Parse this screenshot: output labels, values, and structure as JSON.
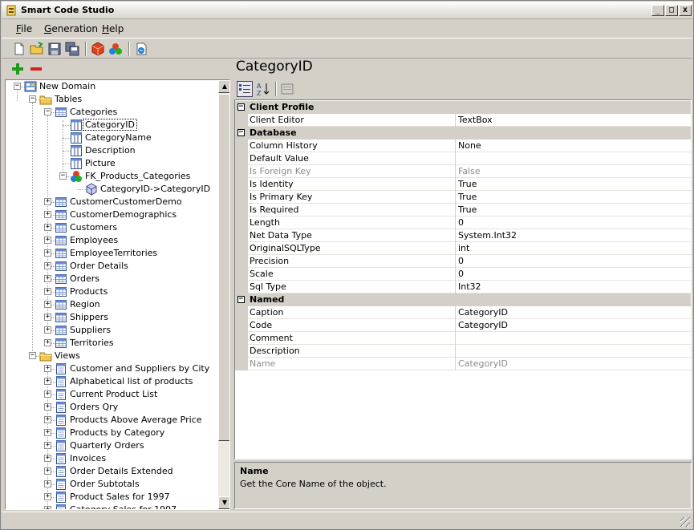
{
  "app": {
    "title": "Smart Code Studio"
  },
  "menu": [
    {
      "label_u": "F",
      "label_rest": "ile"
    },
    {
      "label_u": "G",
      "label_rest": "eneration"
    },
    {
      "label_u": "H",
      "label_rest": "elp"
    }
  ],
  "tree": {
    "root": "New Domain",
    "tables_folder": "Tables",
    "categories": "Categories",
    "columns": [
      "CategoryID",
      "CategoryName",
      "Description",
      "Picture"
    ],
    "fk": "FK_Products_Categories",
    "fk_child": "CategoryID->CategoryID",
    "tables": [
      "CustomerCustomerDemo",
      "CustomerDemographics",
      "Customers",
      "Employees",
      "EmployeeTerritories",
      "Order Details",
      "Orders",
      "Products",
      "Region",
      "Shippers",
      "Suppliers",
      "Territories"
    ],
    "views_folder": "Views",
    "views": [
      "Customer and Suppliers by City",
      "Alphabetical list of products",
      "Current Product List",
      "Orders Qry",
      "Products Above Average Price",
      "Products by Category",
      "Quarterly Orders",
      "Invoices",
      "Order Details Extended",
      "Order Subtotals",
      "Product Sales for 1997",
      "Category Sales for 1997"
    ]
  },
  "properties": {
    "title": "CategoryID",
    "groups": [
      {
        "name": "Client Profile",
        "rows": [
          {
            "name": "Client Editor",
            "value": "TextBox"
          }
        ]
      },
      {
        "name": "Database",
        "rows": [
          {
            "name": "Column History",
            "value": "None"
          },
          {
            "name": "Default Value",
            "value": ""
          },
          {
            "name": "Is Foreign Key",
            "value": "False",
            "disabled": true
          },
          {
            "name": "Is Identity",
            "value": "True"
          },
          {
            "name": "Is Primary Key",
            "value": "True"
          },
          {
            "name": "Is Required",
            "value": "True"
          },
          {
            "name": "Length",
            "value": "0"
          },
          {
            "name": "Net Data Type",
            "value": "System.Int32"
          },
          {
            "name": "OriginalSQLType",
            "value": "int"
          },
          {
            "name": "Precision",
            "value": "0"
          },
          {
            "name": "Scale",
            "value": "0"
          },
          {
            "name": "Sql Type",
            "value": "Int32"
          }
        ]
      },
      {
        "name": "Named",
        "rows": [
          {
            "name": "Caption",
            "value": "CategoryID"
          },
          {
            "name": "Code",
            "value": "CategoryID"
          },
          {
            "name": "Comment",
            "value": ""
          },
          {
            "name": "Description",
            "value": ""
          },
          {
            "name": "Name",
            "value": "CategoryID",
            "disabled": true
          }
        ]
      }
    ]
  },
  "description": {
    "title": "Name",
    "text": "Get the Core Name of the object."
  },
  "colors": {
    "accent_green": "#1e9b1e",
    "accent_red": "#d42020",
    "folder": "#f0c850"
  }
}
